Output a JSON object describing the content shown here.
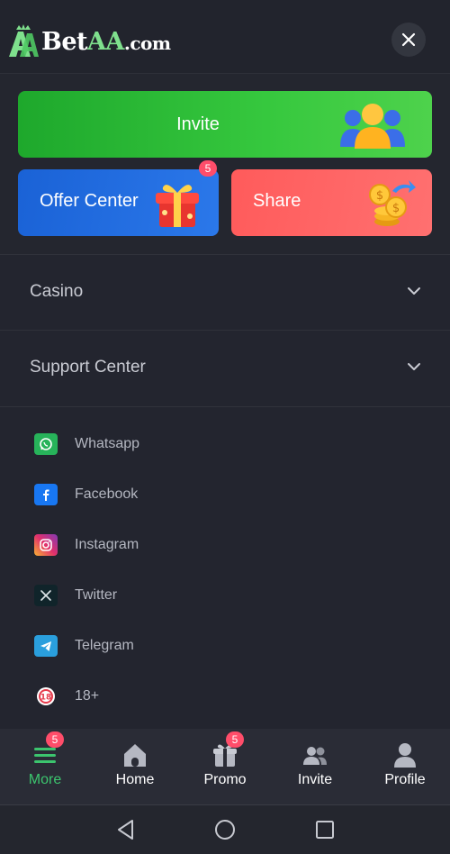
{
  "brand": {
    "part1": "Bet",
    "part2": "AA",
    "part3": ".com"
  },
  "cards": {
    "invite_label": "Invite",
    "offer_label": "Offer Center",
    "offer_badge": "5",
    "share_label": "Share"
  },
  "sections": [
    {
      "label": "Casino"
    },
    {
      "label": "Support Center"
    }
  ],
  "social": [
    {
      "label": "Whatsapp",
      "icon": "whatsapp-icon"
    },
    {
      "label": "Facebook",
      "icon": "facebook-icon"
    },
    {
      "label": "Instagram",
      "icon": "instagram-icon"
    },
    {
      "label": "Twitter",
      "icon": "twitter-icon"
    },
    {
      "label": "Telegram",
      "icon": "telegram-icon"
    },
    {
      "label": "18+",
      "icon": "age-18-icon"
    }
  ],
  "nav": [
    {
      "label": "More",
      "icon": "menu-icon",
      "badge": "5",
      "active": true
    },
    {
      "label": "Home",
      "icon": "home-icon"
    },
    {
      "label": "Promo",
      "icon": "gift-icon",
      "badge": "5"
    },
    {
      "label": "Invite",
      "icon": "users-icon"
    },
    {
      "label": "Profile",
      "icon": "person-icon"
    }
  ],
  "colors": {
    "accent": "#3cc56e",
    "badge": "#ff4d6a",
    "background": "#23252f"
  }
}
